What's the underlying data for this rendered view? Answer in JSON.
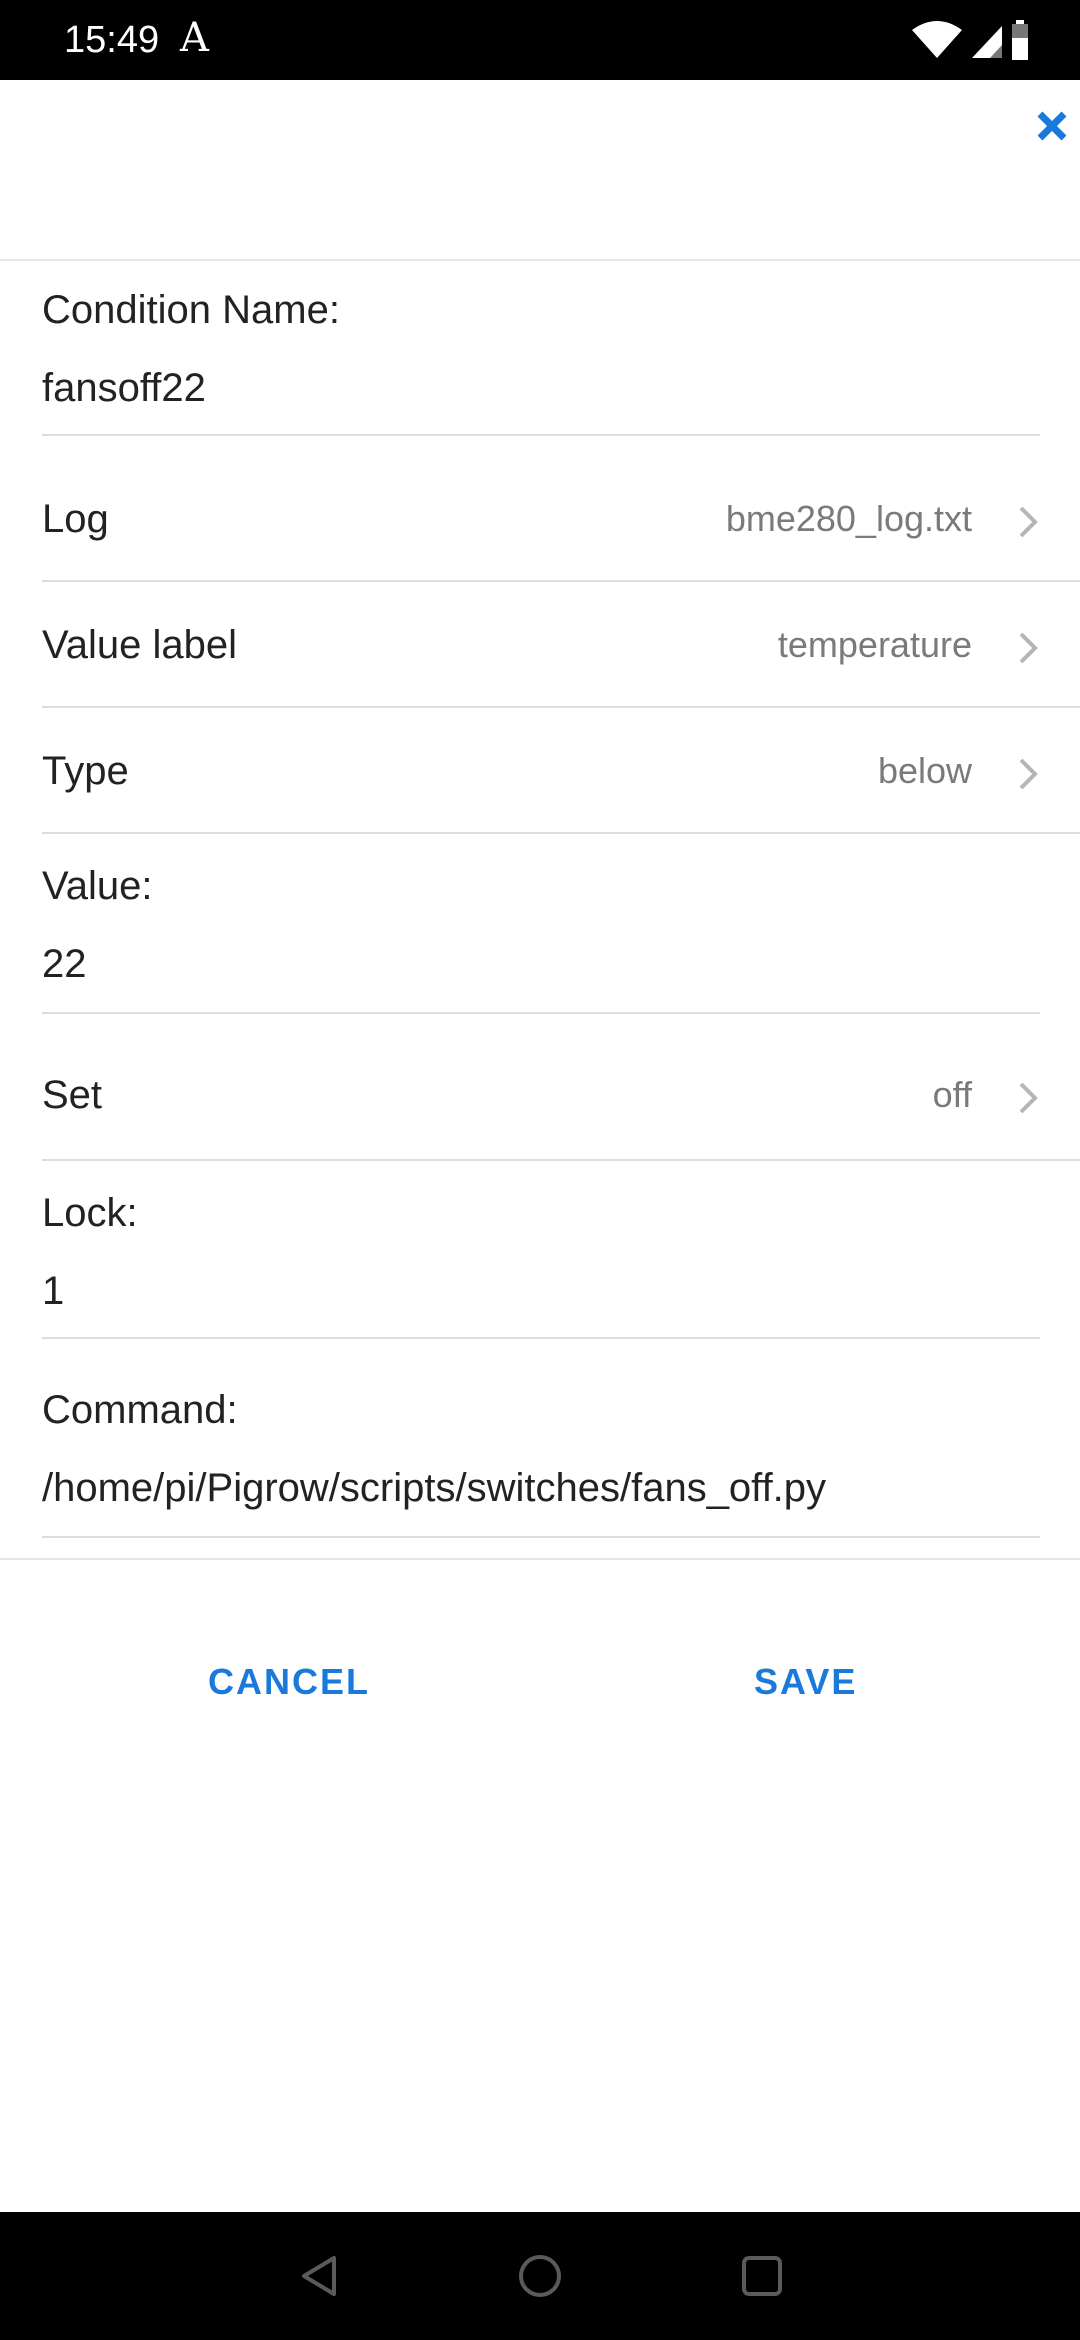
{
  "status_bar": {
    "time": "15:49",
    "notification_glyph": "A",
    "icons": [
      "wifi-icon",
      "signal-icon",
      "battery-icon"
    ]
  },
  "dialog": {
    "close_icon": "close-icon",
    "condition_name": {
      "label": "Condition Name:",
      "value": "fansoff22"
    },
    "log": {
      "label": "Log",
      "value": "bme280_log.txt"
    },
    "value_label": {
      "label": "Value label",
      "value": "temperature"
    },
    "type": {
      "label": "Type",
      "value": "below"
    },
    "value": {
      "label": "Value:",
      "value": "22"
    },
    "set": {
      "label": "Set",
      "value": "off"
    },
    "lock": {
      "label": "Lock:",
      "value": "1"
    },
    "command": {
      "label": "Command:",
      "value": "/home/pi/Pigrow/scripts/switches/fans_off.py"
    },
    "cancel_label": "CANCEL",
    "save_label": "SAVE"
  },
  "colors": {
    "accent": "#1a7adb",
    "text": "#222222",
    "secondary_text": "#7a7a7a",
    "divider": "#dcdcdc"
  },
  "nav_bar": {
    "icons": [
      "back-icon",
      "home-icon",
      "recents-icon"
    ]
  }
}
